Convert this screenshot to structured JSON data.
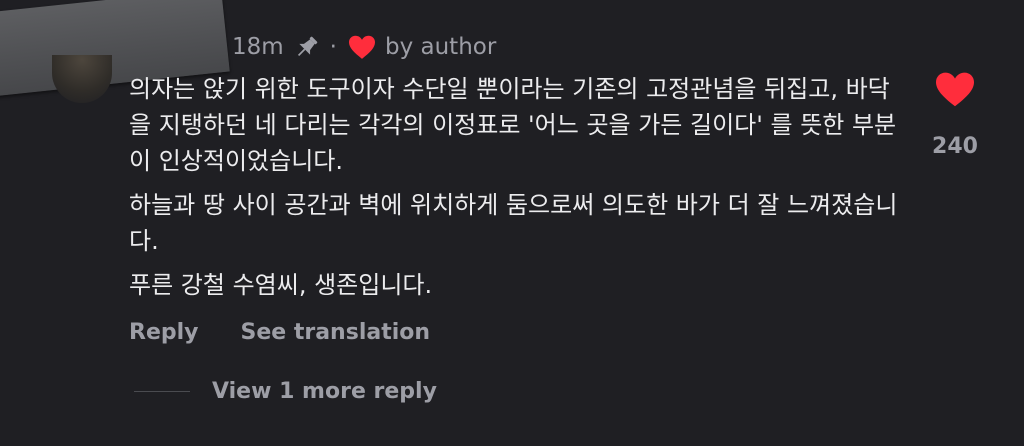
{
  "comment": {
    "time": "18m",
    "dot": "·",
    "by_author": "by author",
    "paragraphs": [
      "의자는 앉기 위한 도구이자 수단일 뿐이라는 기존의 고정관념을 뒤집고, 바닥을 지탱하던 네 다리는 각각의 이정표로 '어느 곳을 가든 길이다' 를 뜻한 부분이 인상적이었습니다.",
      "하늘과 땅 사이 공간과 벽에 위치하게 둠으로써 의도한 바가 더 잘 느껴졌습니다.",
      "푸른 강철 수염씨, 생존입니다."
    ],
    "like_count": "240",
    "reply_label": "Reply",
    "see_translation_label": "See translation",
    "view_more_replies_label": "View 1 more reply"
  },
  "icons": {
    "pin": "pin-icon",
    "heart_small": "heart-icon",
    "like": "heart-icon"
  },
  "colors": {
    "background": "#1f1f23",
    "heart": "#ff2d3c",
    "text_primary": "#ececee",
    "text_secondary": "#9d9ea6"
  }
}
